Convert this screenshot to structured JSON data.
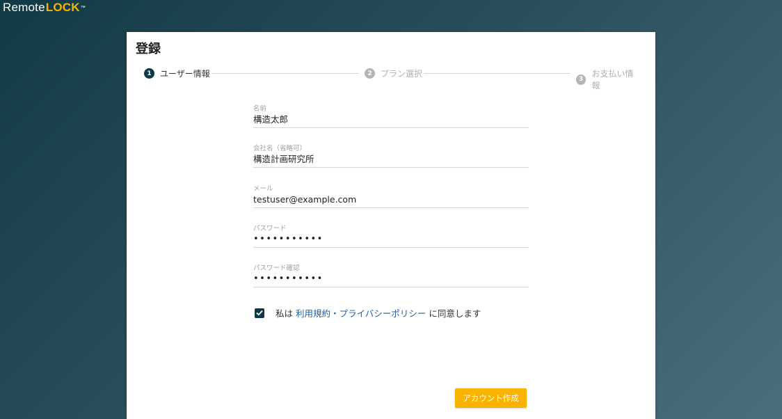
{
  "logo": {
    "text_main": "Remote",
    "text_brand": "LOCK",
    "trademark": "™"
  },
  "page": {
    "title": "登録"
  },
  "stepper": {
    "steps": [
      {
        "number": "1",
        "label": "ユーザー情報",
        "state": "active"
      },
      {
        "number": "2",
        "label": "プラン選択",
        "state": "inactive"
      },
      {
        "number": "3",
        "label": "お支払い情報",
        "state": "inactive"
      }
    ]
  },
  "form": {
    "name": {
      "label": "名前",
      "value": "構造太郎"
    },
    "company": {
      "label": "会社名（省略可）",
      "value": "構造計画研究所"
    },
    "email": {
      "label": "メール",
      "value": "testuser@example.com"
    },
    "password": {
      "label": "パスワード",
      "value": "•••••••••••"
    },
    "password_confirm": {
      "label": "パスワード確認",
      "value": "•••••••••••"
    },
    "agreement": {
      "checked": true,
      "prefix": "私は",
      "terms_link": "利用規約",
      "separator": "・",
      "privacy_link": "プライバシーポリシー",
      "suffix": "に同意します"
    },
    "submit_label": "アカウント作成"
  },
  "colors": {
    "accent": "#f9b300",
    "primary": "#0d3a47",
    "link": "#1f5e9c"
  }
}
